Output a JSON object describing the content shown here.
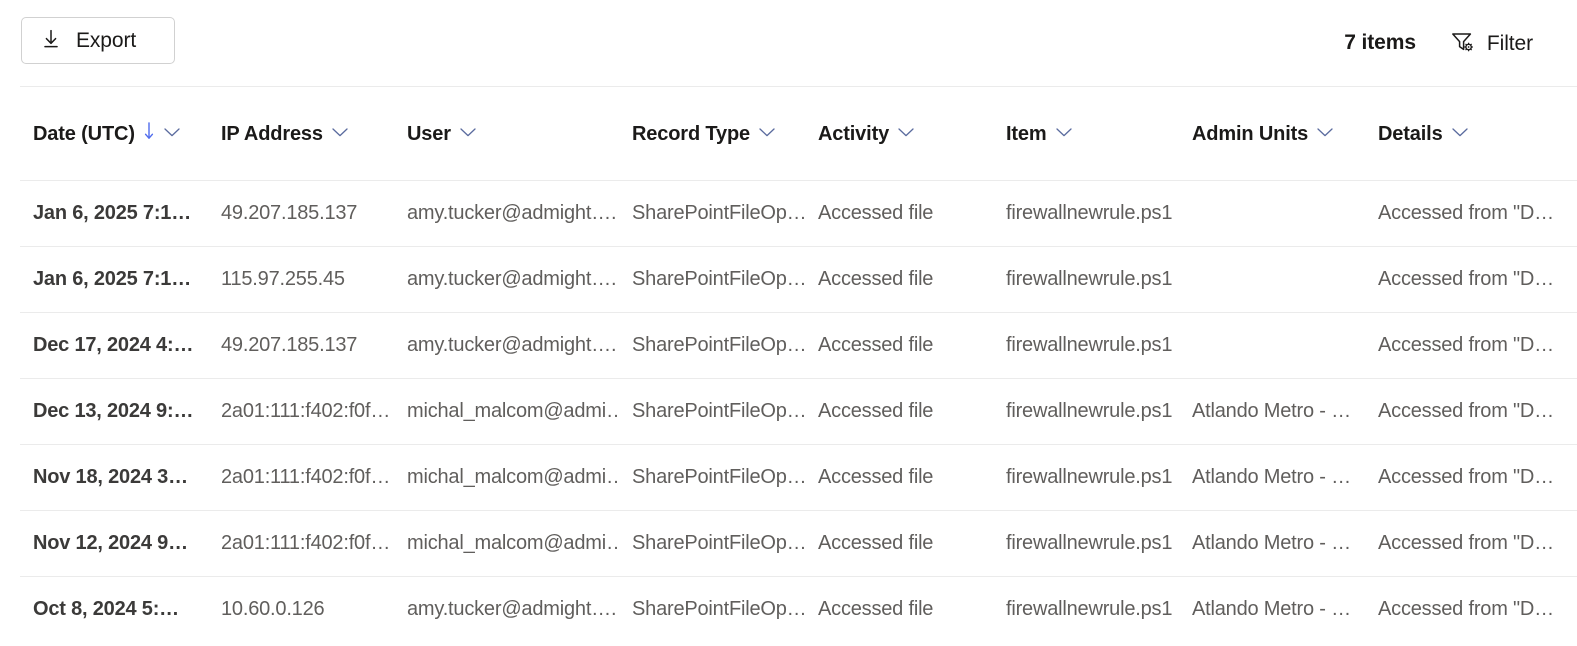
{
  "toolbar": {
    "export_label": "Export",
    "export_icon": "download-icon",
    "item_count": "7 items",
    "filter_label": "Filter",
    "filter_icon": "filter-gear-icon"
  },
  "table": {
    "columns": [
      {
        "key": "date",
        "label": "Date (UTC)",
        "sorted": "desc",
        "icon": "chevron-down-icon"
      },
      {
        "key": "ip",
        "label": "IP Address",
        "sorted": "",
        "icon": "chevron-down-icon"
      },
      {
        "key": "user",
        "label": "User",
        "sorted": "",
        "icon": "chevron-down-icon"
      },
      {
        "key": "record",
        "label": "Record Type",
        "sorted": "",
        "icon": "chevron-down-icon"
      },
      {
        "key": "act",
        "label": "Activity",
        "sorted": "",
        "icon": "chevron-down-icon"
      },
      {
        "key": "item",
        "label": "Item",
        "sorted": "",
        "icon": "chevron-down-icon"
      },
      {
        "key": "admin",
        "label": "Admin Units",
        "sorted": "",
        "icon": "chevron-down-icon"
      },
      {
        "key": "det",
        "label": "Details",
        "sorted": "",
        "icon": "chevron-down-icon"
      }
    ],
    "rows": [
      {
        "date": "Jan 6, 2025 7:1…",
        "ip": "49.207.185.137",
        "user": "amy.tucker@admight….",
        "record": "SharePointFileOp…",
        "act": "Accessed file",
        "item": "firewallnewrule.ps1",
        "admin": "",
        "det": "Accessed from \"D…"
      },
      {
        "date": "Jan 6, 2025 7:1…",
        "ip": "115.97.255.45",
        "user": "amy.tucker@admight….",
        "record": "SharePointFileOp…",
        "act": "Accessed file",
        "item": "firewallnewrule.ps1",
        "admin": "",
        "det": "Accessed from \"D…"
      },
      {
        "date": "Dec 17, 2024 4:…",
        "ip": "49.207.185.137",
        "user": "amy.tucker@admight….",
        "record": "SharePointFileOp…",
        "act": "Accessed file",
        "item": "firewallnewrule.ps1",
        "admin": "",
        "det": "Accessed from \"D…"
      },
      {
        "date": "Dec 13, 2024 9:…",
        "ip": "2a01:111:f402:f0f…",
        "user": "michal_malcom@admi…",
        "record": "SharePointFileOp…",
        "act": "Accessed file",
        "item": "firewallnewrule.ps1",
        "admin": "Atlando Metro - …",
        "det": "Accessed from \"D…"
      },
      {
        "date": "Nov 18, 2024 3…",
        "ip": "2a01:111:f402:f0f…",
        "user": "michal_malcom@admi…",
        "record": "SharePointFileOp…",
        "act": "Accessed file",
        "item": "firewallnewrule.ps1",
        "admin": "Atlando Metro - …",
        "det": "Accessed from \"D…"
      },
      {
        "date": "Nov 12, 2024 9…",
        "ip": "2a01:111:f402:f0f…",
        "user": "michal_malcom@admi…",
        "record": "SharePointFileOp…",
        "act": "Accessed file",
        "item": "firewallnewrule.ps1",
        "admin": "Atlando Metro - …",
        "det": "Accessed from \"D…"
      },
      {
        "date": "Oct 8, 2024 5:…",
        "ip": "10.60.0.126",
        "user": "amy.tucker@admight….",
        "record": "SharePointFileOp…",
        "act": "Accessed file",
        "item": "firewallnewrule.ps1",
        "admin": "Atlando Metro - …",
        "det": "Accessed from \"D…"
      }
    ]
  },
  "colors": {
    "text_primary": "#1b1a19",
    "text_row_primary": "#3b3a39",
    "text_muted": "#605e5c",
    "divider": "#ebebeb",
    "button_border": "#d1d1d1",
    "background": "#ffffff"
  }
}
